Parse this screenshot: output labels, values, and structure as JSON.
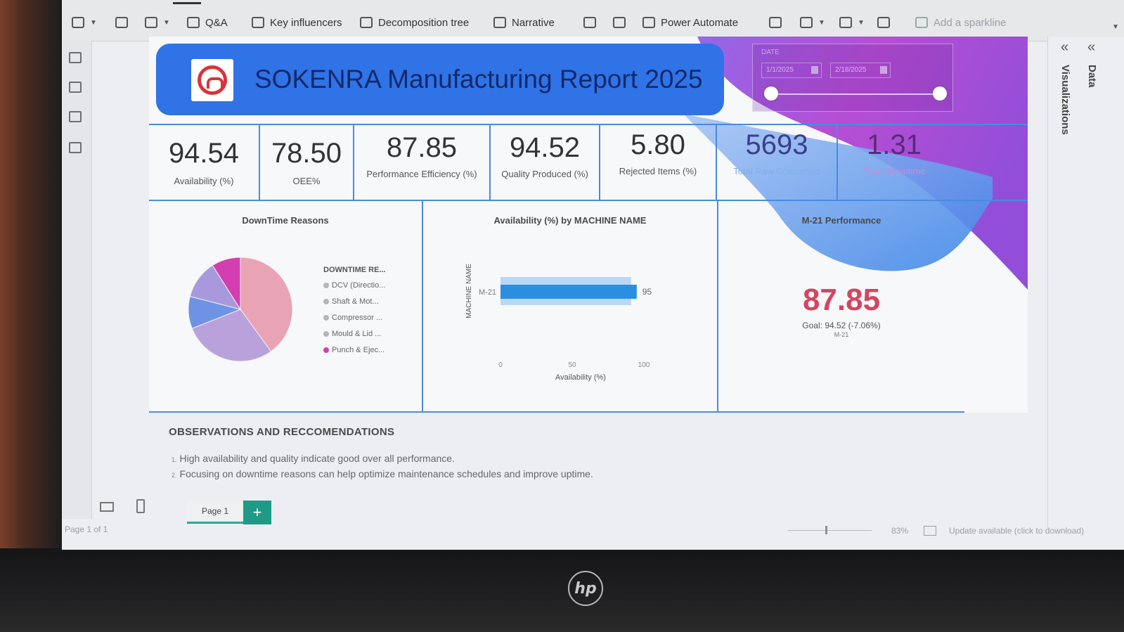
{
  "ribbon": {
    "items": [
      {
        "label": ""
      },
      {
        "label": ""
      },
      {
        "label": ""
      },
      {
        "label": "Q&A"
      },
      {
        "label": "Key influencers"
      },
      {
        "label": "Decomposition tree"
      },
      {
        "label": "Narrative"
      },
      {
        "label": ""
      },
      {
        "label": ""
      },
      {
        "label": "Power Automate"
      },
      {
        "label": "Add a sparkline"
      }
    ]
  },
  "report": {
    "title": "SOKENRA Manufacturing Report 2025",
    "slicer": {
      "label": "DATE",
      "start": "1/1/2025",
      "end": "2/18/2025"
    }
  },
  "kpis": [
    {
      "value": "94.54",
      "label": "Availability (%)"
    },
    {
      "value": "78.50",
      "label": "OEE%"
    },
    {
      "value": "87.85",
      "label": "Performance Efficiency (%)"
    },
    {
      "value": "94.52",
      "label": "Quality Produced (%)"
    },
    {
      "value": "5.80",
      "label": "Rejected Items (%)"
    },
    {
      "value": "5693",
      "label": "Total Raw Consumed"
    },
    {
      "value": "1.31",
      "label": "Total Downtime"
    }
  ],
  "downtime": {
    "title": "DownTime Reasons",
    "legend_title": "DOWNTIME RE...",
    "items": [
      {
        "label": "DCV (Directio...",
        "color": "#e8a3b4"
      },
      {
        "label": "Shaft & Mot...",
        "color": "#b9a2dc"
      },
      {
        "label": "Compressor ...",
        "color": "#6f93e4"
      },
      {
        "label": "Mould & Lid ...",
        "color": "#a899dc"
      },
      {
        "label": "Punch & Ejec...",
        "color": "#d33fb0"
      }
    ]
  },
  "availability_chart": {
    "title": "Availability (%) by MACHINE NAME",
    "ylabel": "MACHINE NAME",
    "xlabel": "Availability (%)"
  },
  "m21": {
    "title": "M-21 Performance",
    "value": "87.85",
    "goal": "Goal: 94.52 (-7.06%)",
    "name": "M-21"
  },
  "observations": {
    "title": "OBSERVATIONS AND RECCOMENDATIONS",
    "items": [
      {
        "n": "1.",
        "text": "High availability and quality indicate good over all performance."
      },
      {
        "n": "2.",
        "text": "Focusing on downtime reasons can help optimize maintenance schedules and improve uptime."
      }
    ]
  },
  "panes": {
    "visualizations": "Visualizations",
    "data": "Data"
  },
  "pages": {
    "tab": "Page 1",
    "add": "+"
  },
  "status": {
    "page_of": "Page 1 of 1",
    "zoom": "83%",
    "update": "Update available (click to download)"
  },
  "brand": {
    "laptop": "hp"
  },
  "chart_data": [
    {
      "type": "pie",
      "title": "DownTime Reasons",
      "legend_title": "DOWNTIME RE...",
      "categories": [
        "DCV (Directio...",
        "Shaft & Mot...",
        "Compressor ...",
        "Mould & Lid ...",
        "Punch & Ejec..."
      ],
      "values": [
        40,
        29,
        10,
        12,
        9
      ],
      "colors": [
        "#e8a3b4",
        "#b9a2dc",
        "#6f93e4",
        "#a899dc",
        "#d33fb0"
      ],
      "legend": "right"
    },
    {
      "type": "bar",
      "orientation": "horizontal",
      "title": "Availability (%) by MACHINE NAME",
      "categories": [
        "M-21"
      ],
      "values": [
        95
      ],
      "xlabel": "Availability (%)",
      "ylabel": "MACHINE NAME",
      "xlim": [
        0,
        100
      ],
      "xticks": [
        "0",
        "50",
        "100"
      ],
      "data_labels": [
        "95"
      ],
      "color": "#2a8fe0"
    }
  ]
}
